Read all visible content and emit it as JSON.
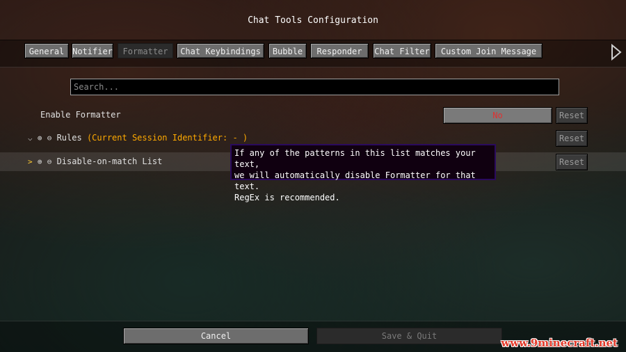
{
  "window": {
    "title": "Chat Tools Configuration"
  },
  "tabs": [
    {
      "label": "General"
    },
    {
      "label": "Notifier"
    },
    {
      "label": "Formatter",
      "active": true
    },
    {
      "label": "Chat Keybindings"
    },
    {
      "label": "Bubble"
    },
    {
      "label": "Responder"
    },
    {
      "label": "Chat Filter"
    },
    {
      "label": "Custom Join Message"
    }
  ],
  "search": {
    "placeholder": "Search..."
  },
  "options": {
    "enable_formatter": {
      "label": "Enable Formatter",
      "value": "No",
      "reset": "Reset"
    },
    "rules": {
      "label": "Rules",
      "suffix": "(Current Session Identifier: - )",
      "reset": "Reset"
    },
    "disable_list": {
      "label": "Disable-on-match List",
      "reset": "Reset"
    }
  },
  "tooltip": {
    "line1": "If any of the patterns in this list matches your text,",
    "line2": "we will automatically disable Formatter for that text.",
    "line3": "RegEx is recommended."
  },
  "footer": {
    "cancel": "Cancel",
    "save_quit": "Save & Quit"
  },
  "watermark": "www.9minecraft.net",
  "colors": {
    "toggle_no": "#e03030",
    "suffix": "#ffaa00",
    "tooltip_border": "#2a0a5e"
  },
  "icons": [
    "chevron-down-icon",
    "chevron-right-icon",
    "plus-circle-icon",
    "minus-circle-icon",
    "scroll-right-icon"
  ]
}
